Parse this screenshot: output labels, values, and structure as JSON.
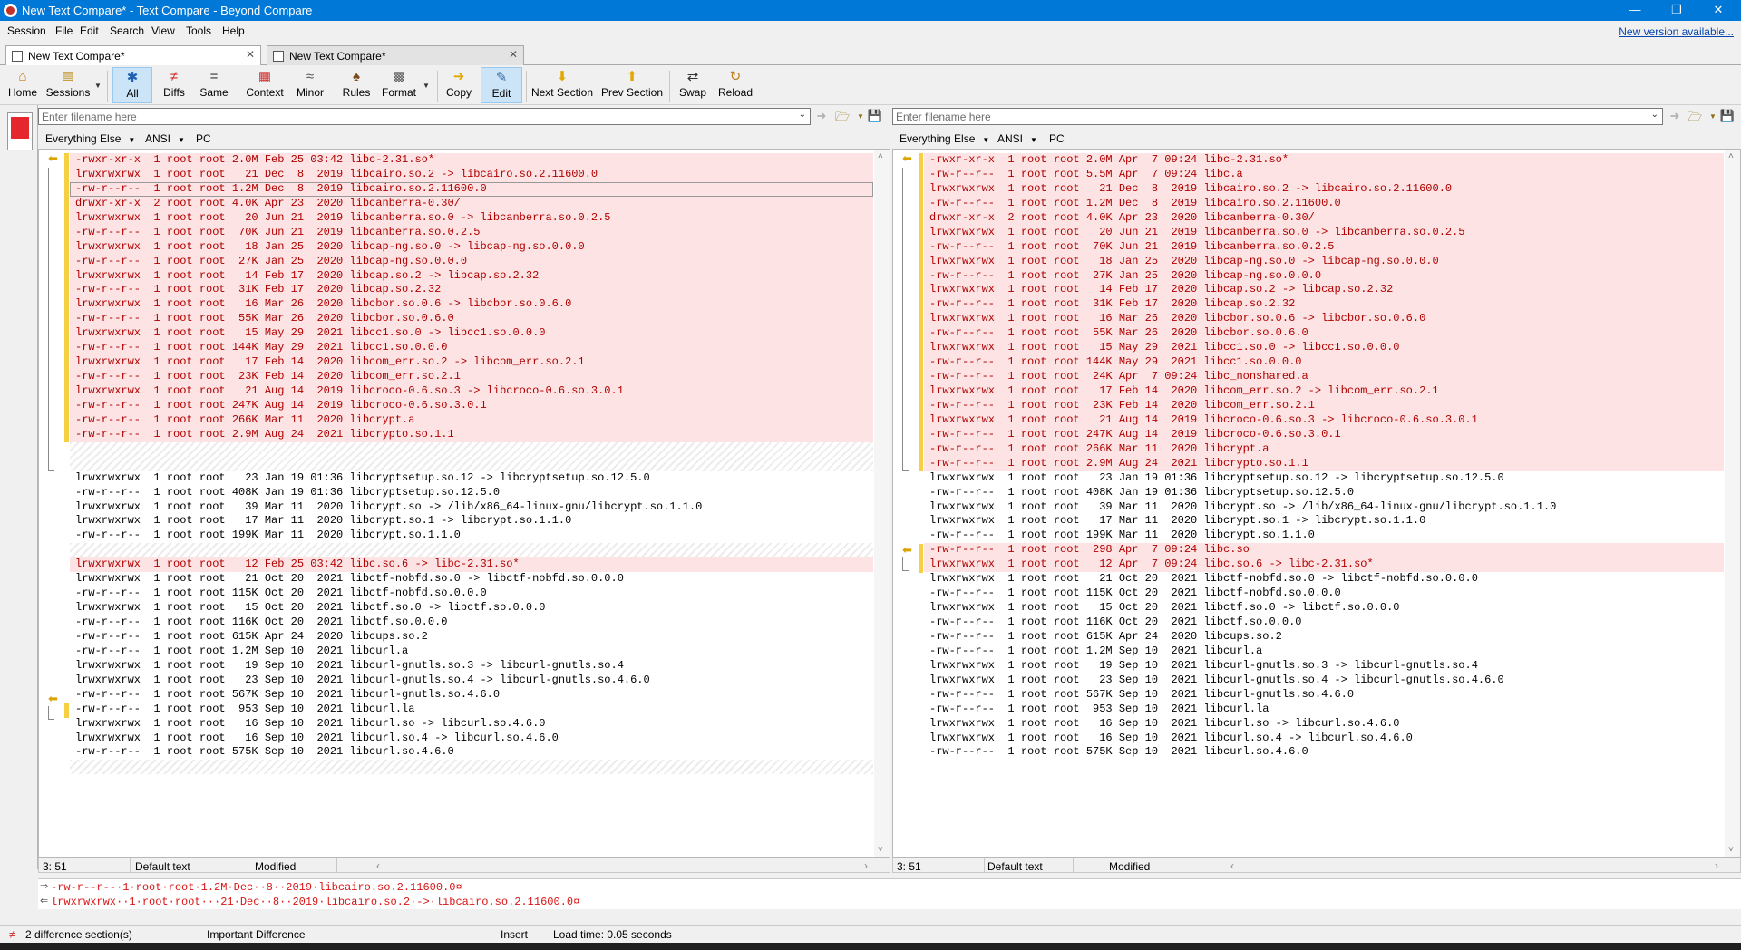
{
  "window": {
    "title": "New Text Compare* - Text Compare - Beyond Compare"
  },
  "menu": {
    "items": [
      "Session",
      "File",
      "Edit",
      "Search",
      "View",
      "Tools",
      "Help"
    ],
    "new_version": "New version available..."
  },
  "tabs": [
    {
      "label": "New Text Compare*"
    },
    {
      "label": "New Text Compare*"
    }
  ],
  "toolbar": {
    "home": "Home",
    "sessions": "Sessions",
    "all": "All",
    "diffs": "Diffs",
    "same": "Same",
    "context": "Context",
    "minor": "Minor",
    "rules": "Rules",
    "format": "Format",
    "copy": "Copy",
    "edit": "Edit",
    "next_section": "Next Section",
    "prev_section": "Prev Section",
    "swap": "Swap",
    "reload": "Reload"
  },
  "left": {
    "filename_placeholder": "Enter filename here",
    "format": {
      "filter": "Everything Else",
      "encoding": "ANSI",
      "lineend": "PC"
    },
    "lines": [
      {
        "t": "-rwxr-xr-x  1 root root 2.0M Feb 25 03:42 libc-2.31.so*",
        "k": "d"
      },
      {
        "t": "lrwxrwxrwx  1 root root   21 Dec  8  2019 libcairo.so.2 -> libcairo.so.2.11600.0",
        "k": "d"
      },
      {
        "t": "-rw-r--r--  1 root root 1.2M Dec  8  2019 libcairo.so.2.11600.0",
        "k": "d"
      },
      {
        "t": "drwxr-xr-x  2 root root 4.0K Apr 23  2020 libcanberra-0.30/",
        "k": "d"
      },
      {
        "t": "lrwxrwxrwx  1 root root   20 Jun 21  2019 libcanberra.so.0 -> libcanberra.so.0.2.5",
        "k": "d"
      },
      {
        "t": "-rw-r--r--  1 root root  70K Jun 21  2019 libcanberra.so.0.2.5",
        "k": "d"
      },
      {
        "t": "lrwxrwxrwx  1 root root   18 Jan 25  2020 libcap-ng.so.0 -> libcap-ng.so.0.0.0",
        "k": "d"
      },
      {
        "t": "-rw-r--r--  1 root root  27K Jan 25  2020 libcap-ng.so.0.0.0",
        "k": "d"
      },
      {
        "t": "lrwxrwxrwx  1 root root   14 Feb 17  2020 libcap.so.2 -> libcap.so.2.32",
        "k": "d"
      },
      {
        "t": "-rw-r--r--  1 root root  31K Feb 17  2020 libcap.so.2.32",
        "k": "d"
      },
      {
        "t": "lrwxrwxrwx  1 root root   16 Mar 26  2020 libcbor.so.0.6 -> libcbor.so.0.6.0",
        "k": "d"
      },
      {
        "t": "-rw-r--r--  1 root root  55K Mar 26  2020 libcbor.so.0.6.0",
        "k": "d"
      },
      {
        "t": "lrwxrwxrwx  1 root root   15 May 29  2021 libcc1.so.0 -> libcc1.so.0.0.0",
        "k": "d"
      },
      {
        "t": "-rw-r--r--  1 root root 144K May 29  2021 libcc1.so.0.0.0",
        "k": "d"
      },
      {
        "t": "lrwxrwxrwx  1 root root   17 Feb 14  2020 libcom_err.so.2 -> libcom_err.so.2.1",
        "k": "d"
      },
      {
        "t": "-rw-r--r--  1 root root  23K Feb 14  2020 libcom_err.so.2.1",
        "k": "d"
      },
      {
        "t": "lrwxrwxrwx  1 root root   21 Aug 14  2019 libcroco-0.6.so.3 -> libcroco-0.6.so.3.0.1",
        "k": "d"
      },
      {
        "t": "-rw-r--r--  1 root root 247K Aug 14  2019 libcroco-0.6.so.3.0.1",
        "k": "d"
      },
      {
        "t": "-rw-r--r--  1 root root 266K Mar 11  2020 libcrypt.a",
        "k": "d"
      },
      {
        "t": "-rw-r--r--  1 root root 2.9M Aug 24  2021 libcrypto.so.1.1",
        "k": "d"
      },
      {
        "t": "",
        "k": "h"
      },
      {
        "t": "",
        "k": "h"
      },
      {
        "t": "lrwxrwxrwx  1 root root   23 Jan 19 01:36 libcryptsetup.so.12 -> libcryptsetup.so.12.5.0",
        "k": "s"
      },
      {
        "t": "-rw-r--r--  1 root root 408K Jan 19 01:36 libcryptsetup.so.12.5.0",
        "k": "s"
      },
      {
        "t": "lrwxrwxrwx  1 root root   39 Mar 11  2020 libcrypt.so -> /lib/x86_64-linux-gnu/libcrypt.so.1.1.0",
        "k": "s"
      },
      {
        "t": "lrwxrwxrwx  1 root root   17 Mar 11  2020 libcrypt.so.1 -> libcrypt.so.1.1.0",
        "k": "s"
      },
      {
        "t": "-rw-r--r--  1 root root 199K Mar 11  2020 libcrypt.so.1.1.0",
        "k": "s"
      },
      {
        "t": "",
        "k": "h"
      },
      {
        "t": "lrwxrwxrwx  1 root root   12 Feb 25 03:42 libc.so.6 -> libc-2.31.so*",
        "k": "d"
      },
      {
        "t": "lrwxrwxrwx  1 root root   21 Oct 20  2021 libctf-nobfd.so.0 -> libctf-nobfd.so.0.0.0",
        "k": "s"
      },
      {
        "t": "-rw-r--r--  1 root root 115K Oct 20  2021 libctf-nobfd.so.0.0.0",
        "k": "s"
      },
      {
        "t": "lrwxrwxrwx  1 root root   15 Oct 20  2021 libctf.so.0 -> libctf.so.0.0.0",
        "k": "s"
      },
      {
        "t": "-rw-r--r--  1 root root 116K Oct 20  2021 libctf.so.0.0.0",
        "k": "s"
      },
      {
        "t": "-rw-r--r--  1 root root 615K Apr 24  2020 libcups.so.2",
        "k": "s"
      },
      {
        "t": "-rw-r--r--  1 root root 1.2M Sep 10  2021 libcurl.a",
        "k": "s"
      },
      {
        "t": "lrwxrwxrwx  1 root root   19 Sep 10  2021 libcurl-gnutls.so.3 -> libcurl-gnutls.so.4",
        "k": "s"
      },
      {
        "t": "lrwxrwxrwx  1 root root   23 Sep 10  2021 libcurl-gnutls.so.4 -> libcurl-gnutls.so.4.6.0",
        "k": "s"
      },
      {
        "t": "-rw-r--r--  1 root root 567K Sep 10  2021 libcurl-gnutls.so.4.6.0",
        "k": "s"
      },
      {
        "t": "-rw-r--r--  1 root root  953 Sep 10  2021 libcurl.la",
        "k": "s"
      },
      {
        "t": "lrwxrwxrwx  1 root root   16 Sep 10  2021 libcurl.so -> libcurl.so.4.6.0",
        "k": "s"
      },
      {
        "t": "lrwxrwxrwx  1 root root   16 Sep 10  2021 libcurl.so.4 -> libcurl.so.4.6.0",
        "k": "s"
      },
      {
        "t": "-rw-r--r--  1 root root 575K Sep 10  2021 libcurl.so.4.6.0",
        "k": "s"
      },
      {
        "t": "",
        "k": "h"
      }
    ],
    "status": {
      "pos": "3: 51",
      "text": "Default text",
      "state": "Modified"
    }
  },
  "right": {
    "filename_placeholder": "Enter filename here",
    "format": {
      "filter": "Everything Else",
      "encoding": "ANSI",
      "lineend": "PC"
    },
    "lines": [
      {
        "t": "-rwxr-xr-x  1 root root 2.0M Apr  7 09:24 libc-2.31.so*",
        "k": "d"
      },
      {
        "t": "-rw-r--r--  1 root root 5.5M Apr  7 09:24 libc.a",
        "k": "d"
      },
      {
        "t": "lrwxrwxrwx  1 root root   21 Dec  8  2019 libcairo.so.2 -> libcairo.so.2.11600.0",
        "k": "d"
      },
      {
        "t": "-rw-r--r--  1 root root 1.2M Dec  8  2019 libcairo.so.2.11600.0",
        "k": "d"
      },
      {
        "t": "drwxr-xr-x  2 root root 4.0K Apr 23  2020 libcanberra-0.30/",
        "k": "d"
      },
      {
        "t": "lrwxrwxrwx  1 root root   20 Jun 21  2019 libcanberra.so.0 -> libcanberra.so.0.2.5",
        "k": "d"
      },
      {
        "t": "-rw-r--r--  1 root root  70K Jun 21  2019 libcanberra.so.0.2.5",
        "k": "d"
      },
      {
        "t": "lrwxrwxrwx  1 root root   18 Jan 25  2020 libcap-ng.so.0 -> libcap-ng.so.0.0.0",
        "k": "d"
      },
      {
        "t": "-rw-r--r--  1 root root  27K Jan 25  2020 libcap-ng.so.0.0.0",
        "k": "d"
      },
      {
        "t": "lrwxrwxrwx  1 root root   14 Feb 17  2020 libcap.so.2 -> libcap.so.2.32",
        "k": "d"
      },
      {
        "t": "-rw-r--r--  1 root root  31K Feb 17  2020 libcap.so.2.32",
        "k": "d"
      },
      {
        "t": "lrwxrwxrwx  1 root root   16 Mar 26  2020 libcbor.so.0.6 -> libcbor.so.0.6.0",
        "k": "d"
      },
      {
        "t": "-rw-r--r--  1 root root  55K Mar 26  2020 libcbor.so.0.6.0",
        "k": "d"
      },
      {
        "t": "lrwxrwxrwx  1 root root   15 May 29  2021 libcc1.so.0 -> libcc1.so.0.0.0",
        "k": "d"
      },
      {
        "t": "-rw-r--r--  1 root root 144K May 29  2021 libcc1.so.0.0.0",
        "k": "d"
      },
      {
        "t": "-rw-r--r--  1 root root  24K Apr  7 09:24 libc_nonshared.a",
        "k": "d"
      },
      {
        "t": "lrwxrwxrwx  1 root root   17 Feb 14  2020 libcom_err.so.2 -> libcom_err.so.2.1",
        "k": "d"
      },
      {
        "t": "-rw-r--r--  1 root root  23K Feb 14  2020 libcom_err.so.2.1",
        "k": "d"
      },
      {
        "t": "lrwxrwxrwx  1 root root   21 Aug 14  2019 libcroco-0.6.so.3 -> libcroco-0.6.so.3.0.1",
        "k": "d"
      },
      {
        "t": "-rw-r--r--  1 root root 247K Aug 14  2019 libcroco-0.6.so.3.0.1",
        "k": "d"
      },
      {
        "t": "-rw-r--r--  1 root root 266K Mar 11  2020 libcrypt.a",
        "k": "d"
      },
      {
        "t": "-rw-r--r--  1 root root 2.9M Aug 24  2021 libcrypto.so.1.1",
        "k": "d"
      },
      {
        "t": "lrwxrwxrwx  1 root root   23 Jan 19 01:36 libcryptsetup.so.12 -> libcryptsetup.so.12.5.0",
        "k": "s"
      },
      {
        "t": "-rw-r--r--  1 root root 408K Jan 19 01:36 libcryptsetup.so.12.5.0",
        "k": "s"
      },
      {
        "t": "lrwxrwxrwx  1 root root   39 Mar 11  2020 libcrypt.so -> /lib/x86_64-linux-gnu/libcrypt.so.1.1.0",
        "k": "s"
      },
      {
        "t": "lrwxrwxrwx  1 root root   17 Mar 11  2020 libcrypt.so.1 -> libcrypt.so.1.1.0",
        "k": "s"
      },
      {
        "t": "-rw-r--r--  1 root root 199K Mar 11  2020 libcrypt.so.1.1.0",
        "k": "s"
      },
      {
        "t": "-rw-r--r--  1 root root  298 Apr  7 09:24 libc.so",
        "k": "d"
      },
      {
        "t": "lrwxrwxrwx  1 root root   12 Apr  7 09:24 libc.so.6 -> libc-2.31.so*",
        "k": "d"
      },
      {
        "t": "lrwxrwxrwx  1 root root   21 Oct 20  2021 libctf-nobfd.so.0 -> libctf-nobfd.so.0.0.0",
        "k": "s"
      },
      {
        "t": "-rw-r--r--  1 root root 115K Oct 20  2021 libctf-nobfd.so.0.0.0",
        "k": "s"
      },
      {
        "t": "lrwxrwxrwx  1 root root   15 Oct 20  2021 libctf.so.0 -> libctf.so.0.0.0",
        "k": "s"
      },
      {
        "t": "-rw-r--r--  1 root root 116K Oct 20  2021 libctf.so.0.0.0",
        "k": "s"
      },
      {
        "t": "-rw-r--r--  1 root root 615K Apr 24  2020 libcups.so.2",
        "k": "s"
      },
      {
        "t": "-rw-r--r--  1 root root 1.2M Sep 10  2021 libcurl.a",
        "k": "s"
      },
      {
        "t": "lrwxrwxrwx  1 root root   19 Sep 10  2021 libcurl-gnutls.so.3 -> libcurl-gnutls.so.4",
        "k": "s"
      },
      {
        "t": "lrwxrwxrwx  1 root root   23 Sep 10  2021 libcurl-gnutls.so.4 -> libcurl-gnutls.so.4.6.0",
        "k": "s"
      },
      {
        "t": "-rw-r--r--  1 root root 567K Sep 10  2021 libcurl-gnutls.so.4.6.0",
        "k": "s"
      },
      {
        "t": "-rw-r--r--  1 root root  953 Sep 10  2021 libcurl.la",
        "k": "s"
      },
      {
        "t": "lrwxrwxrwx  1 root root   16 Sep 10  2021 libcurl.so -> libcurl.so.4.6.0",
        "k": "s"
      },
      {
        "t": "lrwxrwxrwx  1 root root   16 Sep 10  2021 libcurl.so.4 -> libcurl.so.4.6.0",
        "k": "s"
      },
      {
        "t": "-rw-r--r--  1 root root 575K Sep 10  2021 libcurl.so.4.6.0",
        "k": "s"
      }
    ],
    "status": {
      "pos": "3: 51",
      "text": "Default text",
      "state": "Modified"
    }
  },
  "merge": {
    "line1": "-rw-r--r--·1·root·root·1.2M·Dec··8··2019·libcairo.so.2.11600.0¤",
    "line2": "lrwxrwxrwx··1·root·root···21·Dec··8··2019·libcairo.so.2·->·libcairo.so.2.11600.0¤"
  },
  "statusbar": {
    "sections": "2 difference section(s)",
    "importance": "Important Difference",
    "mode": "Insert",
    "loadtime": "Load time: 0.05 seconds"
  },
  "colors": {
    "accent": "#0078d7",
    "diff_bg": "#fde3e3",
    "diff_text": "#d91515",
    "diff_bar": "#f5d042"
  }
}
